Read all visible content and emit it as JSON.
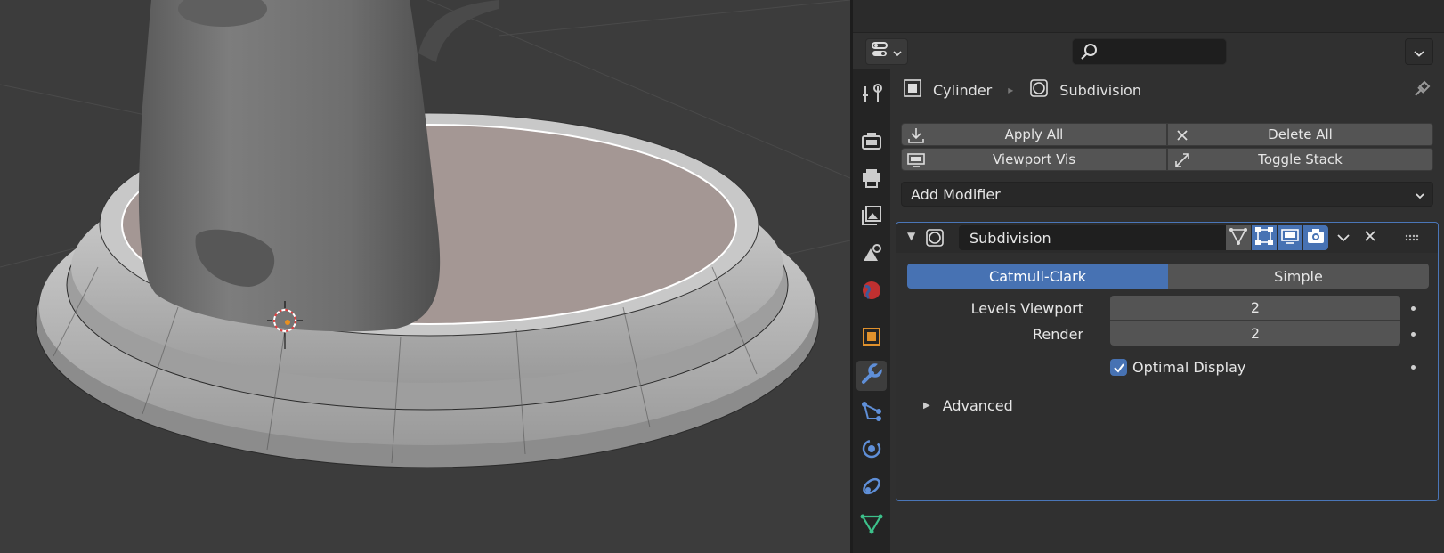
{
  "viewport": {
    "label": "3D Viewport"
  },
  "header": {
    "search_placeholder": "",
    "editor_icon": "properties-editor-icon"
  },
  "tabs": [
    {
      "name": "tool",
      "icon": "wrench-screwdriver-icon"
    },
    {
      "name": "render",
      "icon": "camera-back-icon"
    },
    {
      "name": "output",
      "icon": "printer-icon"
    },
    {
      "name": "view-layer",
      "icon": "image-stack-icon"
    },
    {
      "name": "scene",
      "icon": "scene-icon"
    },
    {
      "name": "world",
      "icon": "world-icon"
    },
    {
      "name": "object",
      "icon": "object-icon"
    },
    {
      "name": "modifiers",
      "icon": "wrench-icon",
      "active": true
    },
    {
      "name": "particles",
      "icon": "particles-icon"
    },
    {
      "name": "physics",
      "icon": "physics-icon"
    },
    {
      "name": "constraints",
      "icon": "constraints-icon"
    },
    {
      "name": "data",
      "icon": "mesh-data-icon"
    }
  ],
  "breadcrumb": {
    "object": "Cylinder",
    "modifier": "Subdivision"
  },
  "toolbar": {
    "apply_all": "Apply All",
    "delete_all": "Delete All",
    "viewport_vis": "Viewport Vis",
    "toggle_stack": "Toggle Stack",
    "add_modifier": "Add Modifier"
  },
  "modifier": {
    "name": "Subdivision",
    "mode_options": [
      "Catmull-Clark",
      "Simple"
    ],
    "selected_mode": "Catmull-Clark",
    "levels_viewport_label": "Levels Viewport",
    "levels_viewport_value": "2",
    "render_label": "Render",
    "render_value": "2",
    "optimal_display_label": "Optimal Display",
    "optimal_display_checked": true,
    "advanced_label": "Advanced"
  },
  "colors": {
    "accent": "#4772b3",
    "background": "#303030",
    "viewport": "#3c3c3c"
  }
}
